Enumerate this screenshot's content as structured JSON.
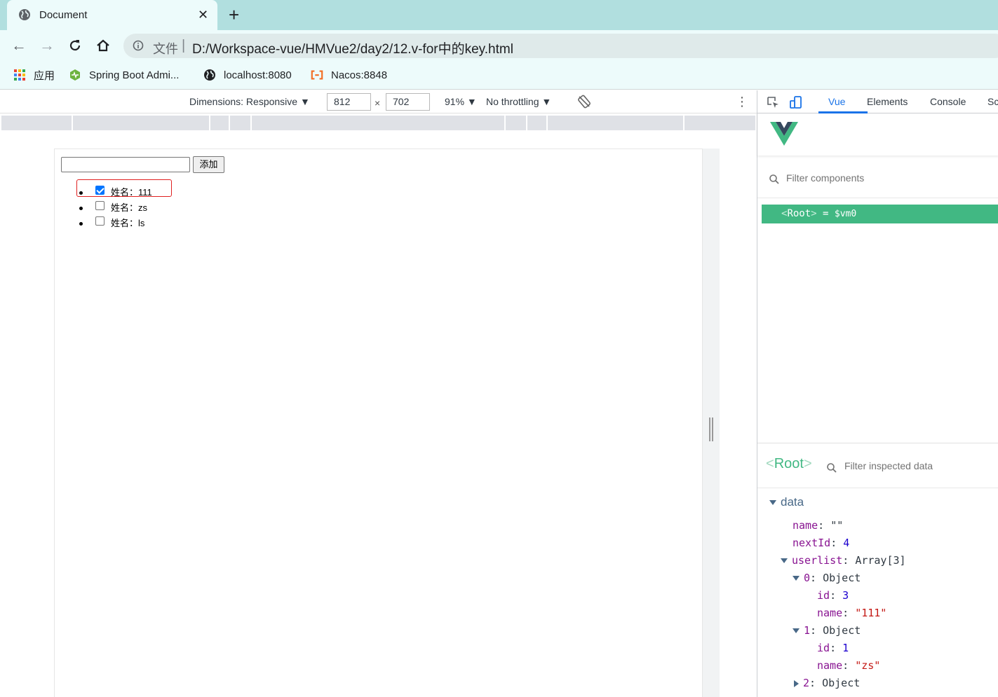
{
  "browser": {
    "tab_title": "Document",
    "tab_close": "✕",
    "new_tab": "+",
    "address_prefix": "文件",
    "address_separator": "|",
    "url": "D:/Workspace-vue/HMVue2/day2/12.v-for中的key.html",
    "bookmarks": [
      {
        "label": "应用",
        "icon": "apps-grid-icon"
      },
      {
        "label": "Spring Boot Admi...",
        "icon": "spring-boot-icon"
      },
      {
        "label": "localhost:8080",
        "icon": "globe-icon"
      },
      {
        "label": "Nacos:8848",
        "icon": "nacos-icon"
      }
    ]
  },
  "device_toolbar": {
    "dimensions_label": "Dimensions: Responsive ▼",
    "width": "812",
    "x": "×",
    "height": "702",
    "zoom": "91% ▼",
    "throttling": "No throttling ▼",
    "more": "⋮"
  },
  "page": {
    "input_value": "",
    "add_button": "添加",
    "items": [
      {
        "label": "姓名：111",
        "checked": true
      },
      {
        "label": "姓名：zs",
        "checked": false
      },
      {
        "label": "姓名：ls",
        "checked": false
      }
    ]
  },
  "devtools": {
    "tabs": [
      "Vue",
      "Elements",
      "Console",
      "Sc"
    ],
    "active_tab": "Vue",
    "filter_components_placeholder": "Filter components",
    "root_row": {
      "open": "<",
      "name": "Root",
      "close": ">",
      "eq": " = ",
      "vm": "$vm0"
    },
    "inspect_root": {
      "open": "<",
      "name": "Root",
      "close": ">"
    },
    "filter_inspected_placeholder": "Filter inspected data",
    "section": "data",
    "data": {
      "name_key": "name",
      "name_val": "\"\"",
      "nextId_key": "nextId",
      "nextId_val": "4",
      "userlist_key": "userlist",
      "userlist_val": "Array[3]",
      "item0_key": "0",
      "item0_val": "Object",
      "item0_id_key": "id",
      "item0_id_val": "3",
      "item0_name_key": "name",
      "item0_name_val": "\"111\"",
      "item1_key": "1",
      "item1_val": "Object",
      "item1_id_key": "id",
      "item1_id_val": "1",
      "item1_name_key": "name",
      "item1_name_val": "\"zs\"",
      "item2_key": "2",
      "item2_val": "Object"
    }
  },
  "colors": {
    "vue_green": "#41b883",
    "tab_strip": "#b1dfdf",
    "toolbar": "#edfbfb",
    "devtools_active": "#1a73e8",
    "highlight_red": "#e02020"
  }
}
